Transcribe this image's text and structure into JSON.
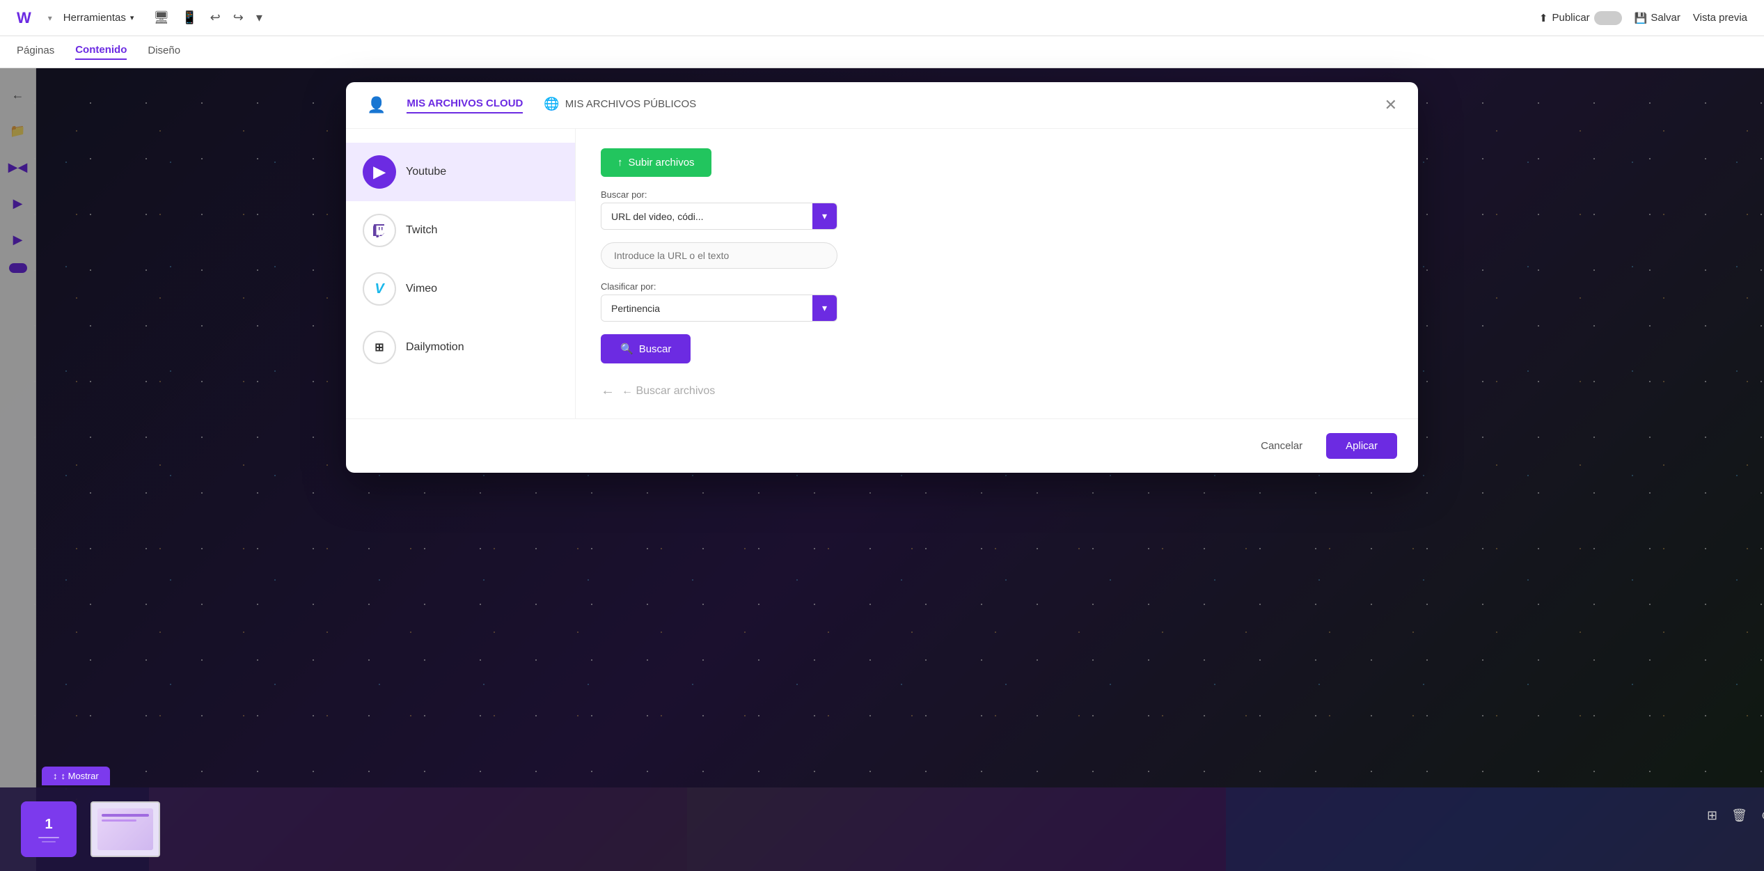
{
  "topbar": {
    "logo": "W",
    "tools_label": "Herramientas",
    "undo_icon": "↩",
    "redo_icon": "↪",
    "more_icon": "▾",
    "publish_label": "Publicar",
    "save_label": "Salvar",
    "preview_label": "Vista previa"
  },
  "navbar": {
    "items": [
      {
        "label": "Páginas",
        "active": false
      },
      {
        "label": "Contenido",
        "active": true
      },
      {
        "label": "Diseño",
        "active": false
      }
    ]
  },
  "modal": {
    "tab_my_files": "MIS ARCHIVOS CLOUD",
    "tab_public_files": "MIS ARCHIVOS PÚBLICOS",
    "close_icon": "✕",
    "sources": [
      {
        "id": "youtube",
        "label": "Youtube",
        "icon": "▶",
        "active": true
      },
      {
        "id": "twitch",
        "label": "Twitch",
        "icon": "🎮",
        "active": false
      },
      {
        "id": "vimeo",
        "label": "Vimeo",
        "icon": "V",
        "active": false
      },
      {
        "id": "dailymotion",
        "label": "Dailymotion",
        "icon": "⊞",
        "active": false
      }
    ],
    "upload_btn_label": "↑ Subir archivos",
    "search_by_label": "Buscar por:",
    "search_select_value": "URL del video, códi...",
    "search_placeholder": "Introduce la URL o el texto",
    "sort_by_label": "Clasificar por:",
    "sort_select_value": "Pertinencia",
    "buscar_btn_label": "🔍 Buscar",
    "results_placeholder": "← Buscar archivos",
    "cancel_label": "Cancelar",
    "apply_label": "Aplicar"
  },
  "bottom_bar": {
    "show_label": "↕ Mostrar",
    "page_number": "1"
  }
}
